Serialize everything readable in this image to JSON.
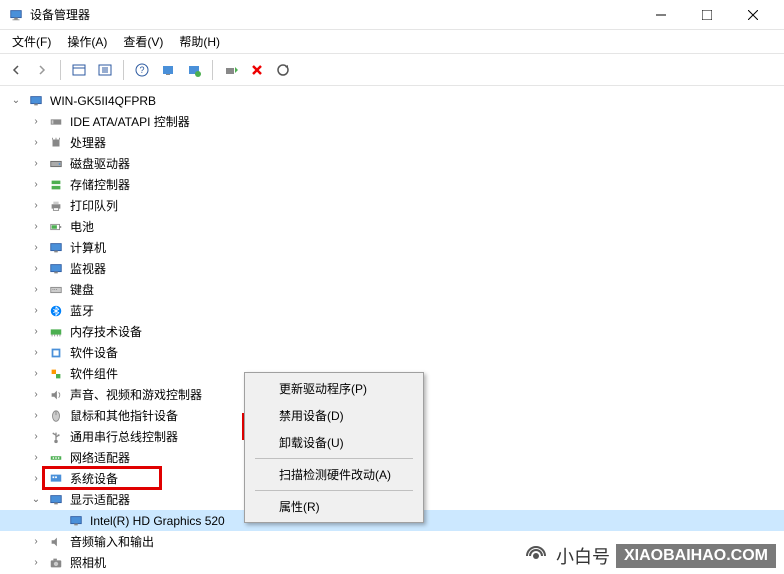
{
  "titlebar": {
    "title": "设备管理器"
  },
  "menubar": {
    "items": [
      "文件(F)",
      "操作(A)",
      "查看(V)",
      "帮助(H)"
    ]
  },
  "tree": {
    "root": "WIN-GK5II4QFPRB",
    "categories": [
      {
        "label": "IDE ATA/ATAPI 控制器",
        "icon": "ide"
      },
      {
        "label": "处理器",
        "icon": "cpu"
      },
      {
        "label": "磁盘驱动器",
        "icon": "disk"
      },
      {
        "label": "存储控制器",
        "icon": "storage"
      },
      {
        "label": "打印队列",
        "icon": "printer"
      },
      {
        "label": "电池",
        "icon": "battery"
      },
      {
        "label": "计算机",
        "icon": "computer"
      },
      {
        "label": "监视器",
        "icon": "monitor"
      },
      {
        "label": "键盘",
        "icon": "keyboard"
      },
      {
        "label": "蓝牙",
        "icon": "bluetooth"
      },
      {
        "label": "内存技术设备",
        "icon": "memory"
      },
      {
        "label": "软件设备",
        "icon": "software"
      },
      {
        "label": "软件组件",
        "icon": "component"
      },
      {
        "label": "声音、视频和游戏控制器",
        "icon": "sound"
      },
      {
        "label": "鼠标和其他指针设备",
        "icon": "mouse"
      },
      {
        "label": "通用串行总线控制器",
        "icon": "usb"
      },
      {
        "label": "网络适配器",
        "icon": "network"
      },
      {
        "label": "系统设备",
        "icon": "system"
      },
      {
        "label": "显示适配器",
        "icon": "display",
        "expanded": true,
        "children": [
          {
            "label": "Intel(R) HD Graphics 520",
            "icon": "display"
          }
        ]
      },
      {
        "label": "音频输入和输出",
        "icon": "audio"
      },
      {
        "label": "照相机",
        "icon": "camera"
      }
    ]
  },
  "context_menu": {
    "items": [
      {
        "label": "更新驱动程序(P)"
      },
      {
        "label": "禁用设备(D)"
      },
      {
        "label": "卸载设备(U)"
      },
      {
        "sep": true
      },
      {
        "label": "扫描检测硬件改动(A)"
      },
      {
        "sep": true
      },
      {
        "label": "属性(R)"
      }
    ]
  },
  "watermark": {
    "small_text": "小白号",
    "domain_text": "XIAOBAIHAO.COM"
  }
}
